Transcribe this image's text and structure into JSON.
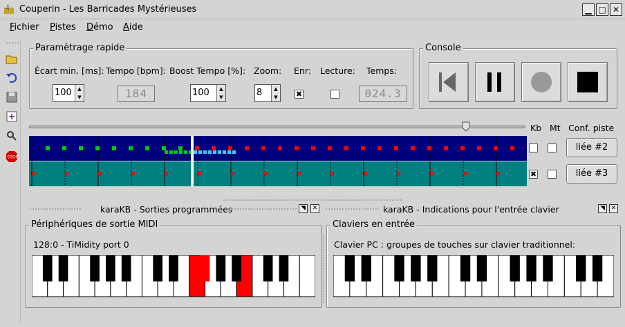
{
  "window": {
    "title": "Couperin - Les Barricades Mystérieuses",
    "minimize_glyph": "▁",
    "maximize_glyph": "□",
    "close_glyph": "✕"
  },
  "menu": [
    {
      "key": "F",
      "rest": "ichier"
    },
    {
      "key": "P",
      "rest": "istes"
    },
    {
      "key": "D",
      "rest": "émo"
    },
    {
      "key": "A",
      "rest": "ide"
    }
  ],
  "toolbar_icons": [
    "open-folder-icon",
    "undo-icon",
    "save-icon",
    "add-track-icon",
    "zoom-icon",
    "stop-icon"
  ],
  "quick": {
    "title": "Paramètrage rapide",
    "ecart_label": "Écart min. [ms]:",
    "ecart_value": "100",
    "tempo_label": "Tempo [bpm]:",
    "tempo_value": "184",
    "boost_label": "Boost Tempo [%]:",
    "boost_value": "100",
    "zoom_label": "Zoom:",
    "zoom_value": "8",
    "enr_label": "Enr:",
    "enr_checked": true,
    "lecture_label": "Lecture:",
    "lecture_checked": false,
    "temps_label": "Temps:",
    "temps_value": "024.3"
  },
  "console": {
    "title": "Console",
    "buttons": [
      "rewind-to-start",
      "pause",
      "record",
      "stop"
    ]
  },
  "tracks": {
    "slider_value": 0.88,
    "kb_label": "Kb",
    "mt_label": "Mt",
    "conf_label": "Conf. piste",
    "rows": [
      {
        "kb": false,
        "mt": false,
        "button": "liée #2"
      },
      {
        "kb": true,
        "mt": false,
        "button": "liée #3"
      }
    ],
    "colors": {
      "track1": "#00007f",
      "track2": "#008080",
      "note_past": "#00cc00",
      "note_future": "#ff0000",
      "note_active": "#33ccff",
      "cursor": "#ffffff"
    }
  },
  "dock": {
    "left_title": "karaKB - Sorties programmées",
    "right_title": "karaKB - Indications pour l'entrée clavier"
  },
  "midi_out": {
    "title": "Périphériques de sortie MIDI",
    "device": "128:0 - TiMidity port 0",
    "highlight_color": "#ff0000"
  },
  "keyboards_in": {
    "title": "Claviers en entrée",
    "description": "Clavier PC : groupes de touches sur clavier traditionnel:",
    "highlight_color": "#ffff00"
  }
}
